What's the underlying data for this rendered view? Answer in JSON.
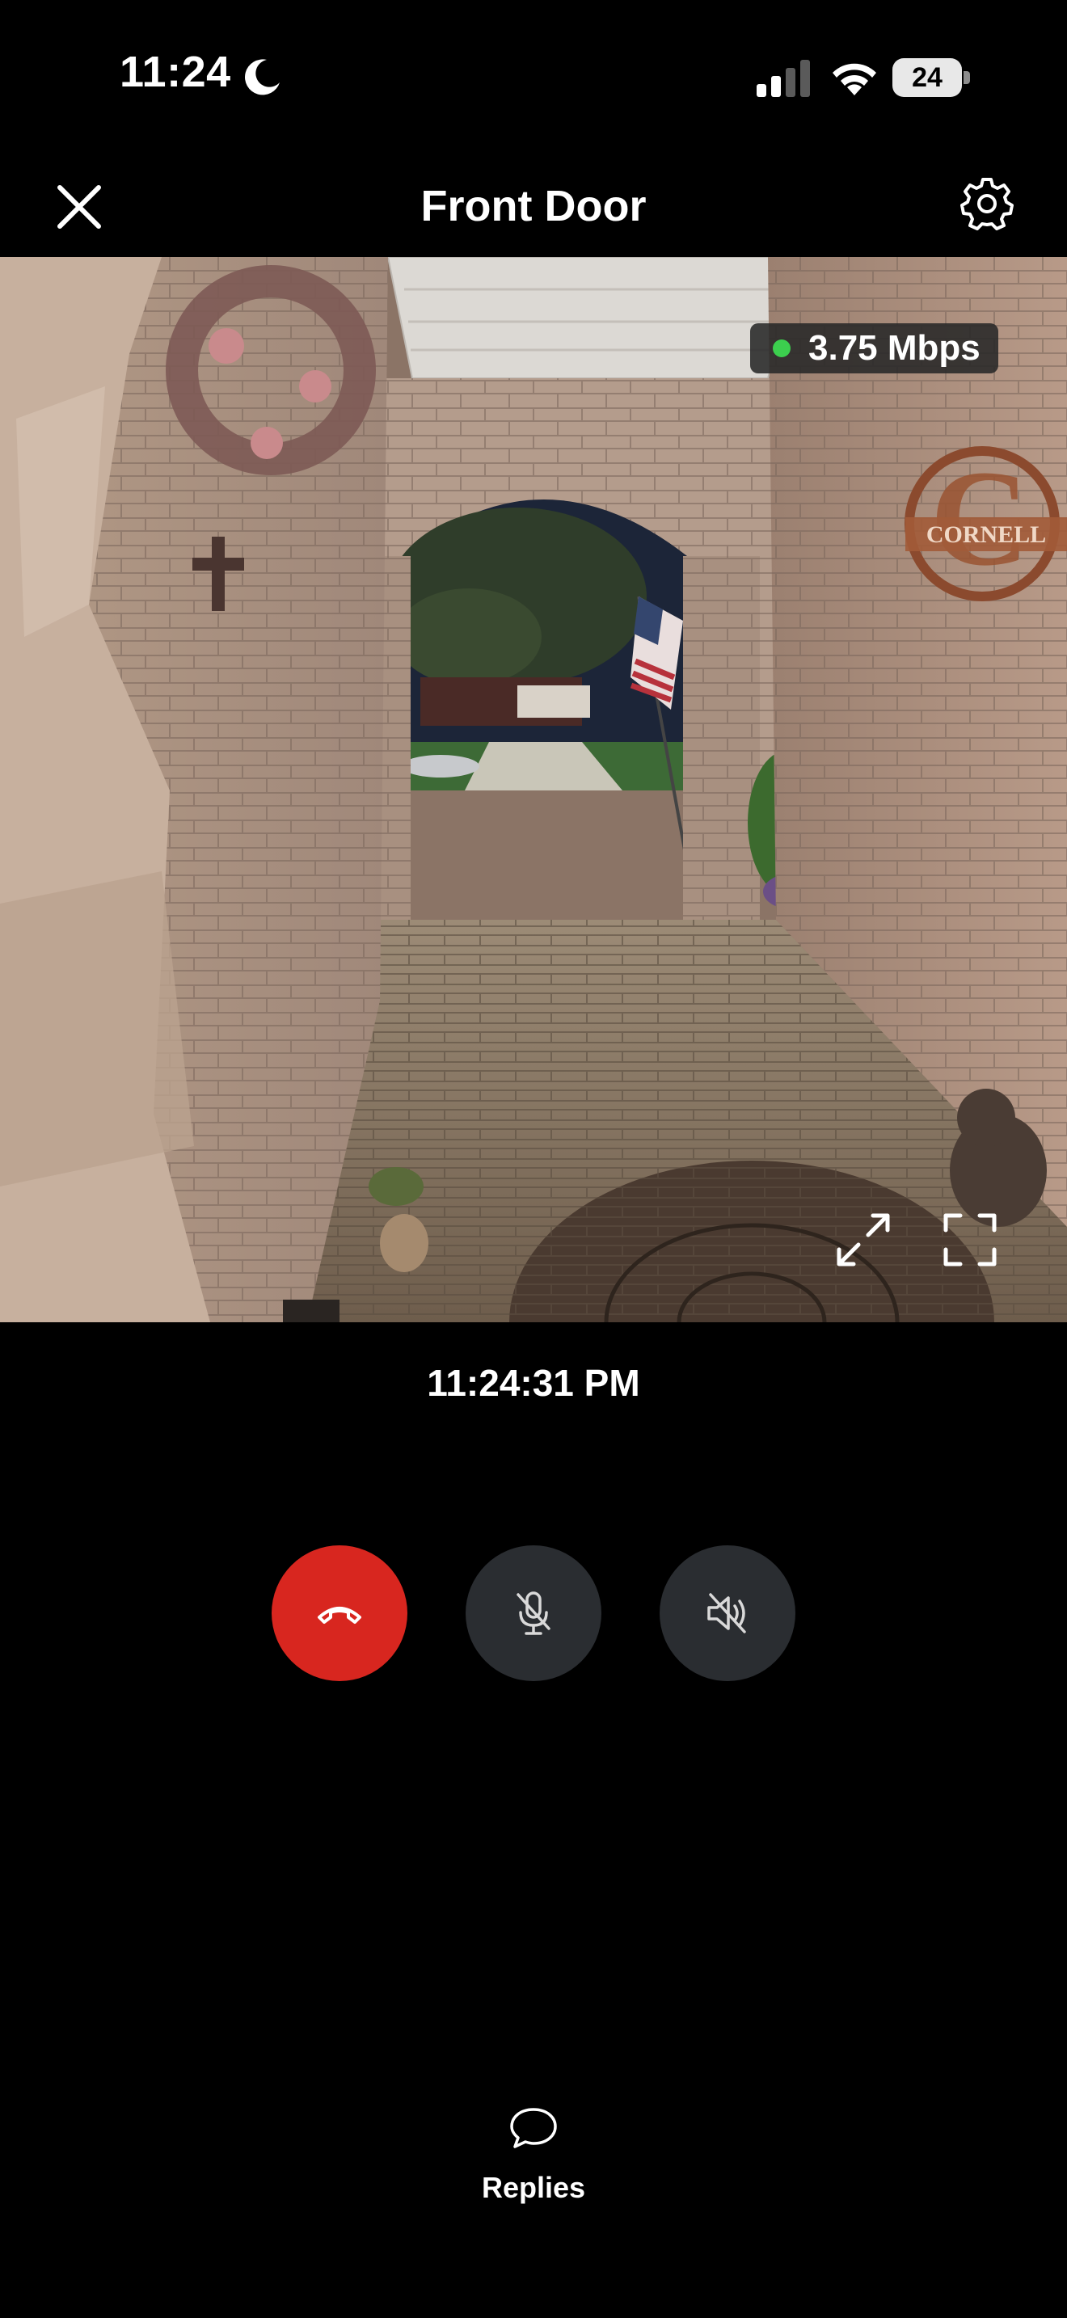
{
  "status_bar": {
    "time": "11:24",
    "battery": "24",
    "icons": [
      "moon-icon",
      "cellular-signal-icon",
      "wifi-icon",
      "battery-icon"
    ]
  },
  "header": {
    "title": "Front Door",
    "close_icon": "close-icon",
    "settings_icon": "gear-icon"
  },
  "live_view": {
    "bitrate": "3.75 Mbps",
    "connection_status_color": "#3ccf4e",
    "expand_icon": "expand-icon",
    "fullscreen_icon": "fullscreen-icon",
    "sign_text": "CORNELL"
  },
  "timestamp": "11:24:31 PM",
  "controls": {
    "end_call_color": "#d8261f",
    "button_color": "#2a2d31",
    "icons": [
      "end-call-icon",
      "microphone-muted-icon",
      "speaker-muted-icon"
    ]
  },
  "replies": {
    "label": "Replies",
    "icon": "chat-bubble-icon"
  }
}
